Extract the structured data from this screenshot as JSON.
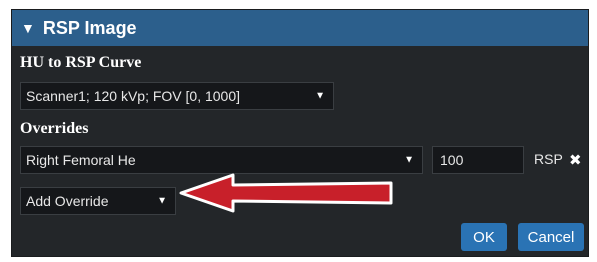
{
  "panel": {
    "title": "RSP Image",
    "collapse_icon": "triangle-down-icon"
  },
  "hu_curve": {
    "label": "HU to RSP Curve",
    "selected": "Scanner1; 120 kVp; FOV [0, 1000]"
  },
  "overrides": {
    "label": "Overrides",
    "items": [
      {
        "structure": "Right Femoral He",
        "value": "100",
        "unit": "RSP"
      }
    ],
    "add_placeholder": "Add Override"
  },
  "buttons": {
    "ok": "OK",
    "cancel": "Cancel"
  },
  "colors": {
    "titlebar": "#2c5f8c",
    "panel": "#232629",
    "button": "#2a73b4",
    "arrow": "#c8202a"
  },
  "annotation": {
    "icon": "red-arrow-icon"
  }
}
